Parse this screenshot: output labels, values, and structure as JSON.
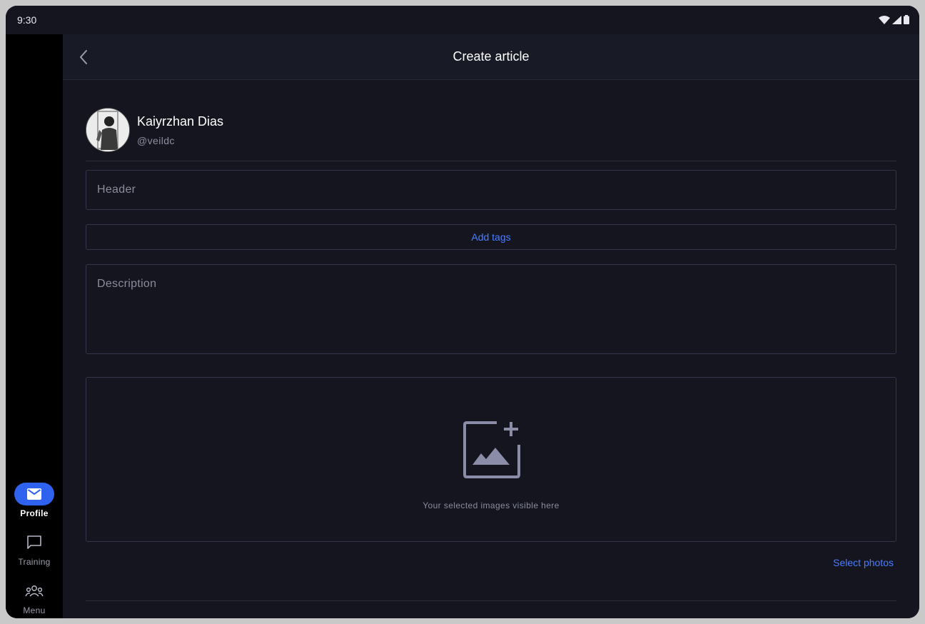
{
  "status_bar": {
    "time": "9:30"
  },
  "nav_rail": {
    "items": [
      {
        "label": "Profile",
        "icon": "mail-icon",
        "active": true
      },
      {
        "label": "Training",
        "icon": "chat-icon",
        "active": false
      },
      {
        "label": "Menu",
        "icon": "group-icon",
        "active": false
      }
    ]
  },
  "header": {
    "title": "Create article"
  },
  "author": {
    "name": "Kaiyrzhan Dias",
    "handle": "@veildc"
  },
  "form": {
    "header_placeholder": "Header",
    "add_tags_label": "Add tags",
    "description_placeholder": "Description",
    "images_hint": "Your selected images visible here",
    "select_photos_label": "Select photos"
  },
  "colors": {
    "accent": "#2f62ee",
    "link": "#4a7dff",
    "background": "#14151f"
  }
}
